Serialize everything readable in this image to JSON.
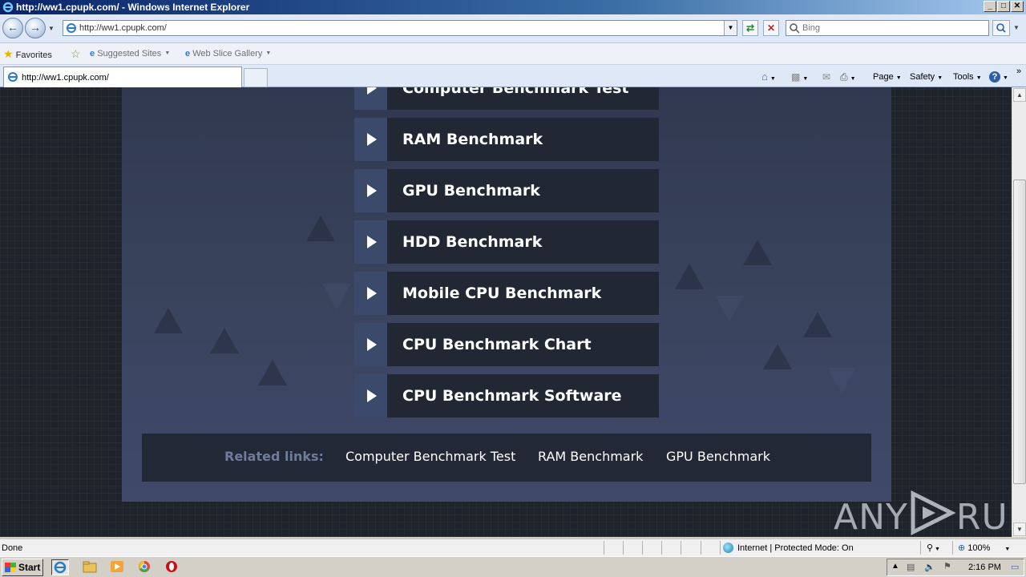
{
  "window": {
    "title": "http://ww1.cpupk.com/ - Windows Internet Explorer",
    "buttons": [
      "_",
      "□",
      "✕"
    ]
  },
  "address_bar": {
    "url": "http://ww1.cpupk.com/",
    "search_placeholder": "Bing"
  },
  "favorites_bar": {
    "favorites_label": "Favorites",
    "items": [
      "Suggested Sites",
      "Web Slice Gallery"
    ]
  },
  "tabs": [
    {
      "title": "http://ww1.cpupk.com/"
    }
  ],
  "command_bar": {
    "items": [
      "Page",
      "Safety",
      "Tools"
    ]
  },
  "page": {
    "partial_top_item": "Computer Benchmark Test",
    "benchmark_items": [
      "RAM Benchmark",
      "GPU Benchmark",
      "HDD Benchmark",
      "Mobile CPU Benchmark",
      "CPU Benchmark Chart",
      "CPU Benchmark Software"
    ],
    "related": {
      "title": "Related links:",
      "links": [
        "Computer Benchmark Test",
        "RAM Benchmark",
        "GPU Benchmark"
      ]
    },
    "watermark": {
      "left": "ANY",
      "right": "RUN"
    }
  },
  "status_bar": {
    "status": "Done",
    "zone": "Internet | Protected Mode: On",
    "zoom": "100%"
  },
  "taskbar": {
    "start_label": "Start",
    "clock": "2:16 PM"
  },
  "colors": {
    "panel": "#39435c",
    "item_label_bg": "#212733",
    "item_arrow_bg": "#3b4a6b",
    "related_title": "#6d7d9a"
  }
}
